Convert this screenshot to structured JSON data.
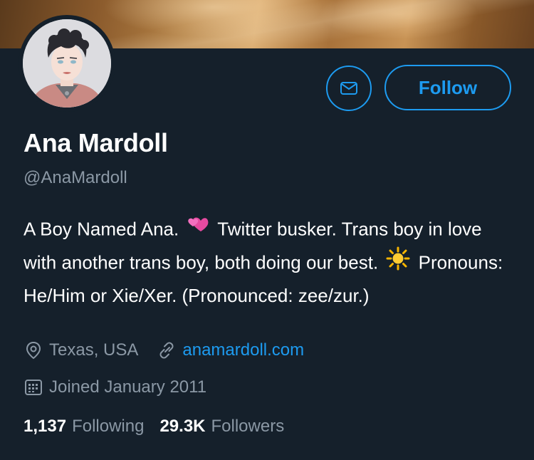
{
  "profile": {
    "display_name": "Ana Mardoll",
    "handle": "@AnaMardoll",
    "bio": {
      "part1": "A Boy Named Ana.",
      "part2": "Twitter busker. Trans boy in love with another trans boy, both doing our best.",
      "part3": "Pronouns: He/Him or Xie/Xer. (Pronounced: zee/zur.)"
    },
    "location": "Texas, USA",
    "website": "anamardoll.com",
    "joined": "Joined January 2011"
  },
  "actions": {
    "follow_label": "Follow",
    "message_icon": "envelope-icon"
  },
  "stats": {
    "following_count": "1,137",
    "following_label": "Following",
    "followers_count": "29.3K",
    "followers_label": "Followers"
  },
  "colors": {
    "background": "#15202b",
    "accent": "#1d9bf0",
    "secondary_text": "#8b98a5"
  }
}
